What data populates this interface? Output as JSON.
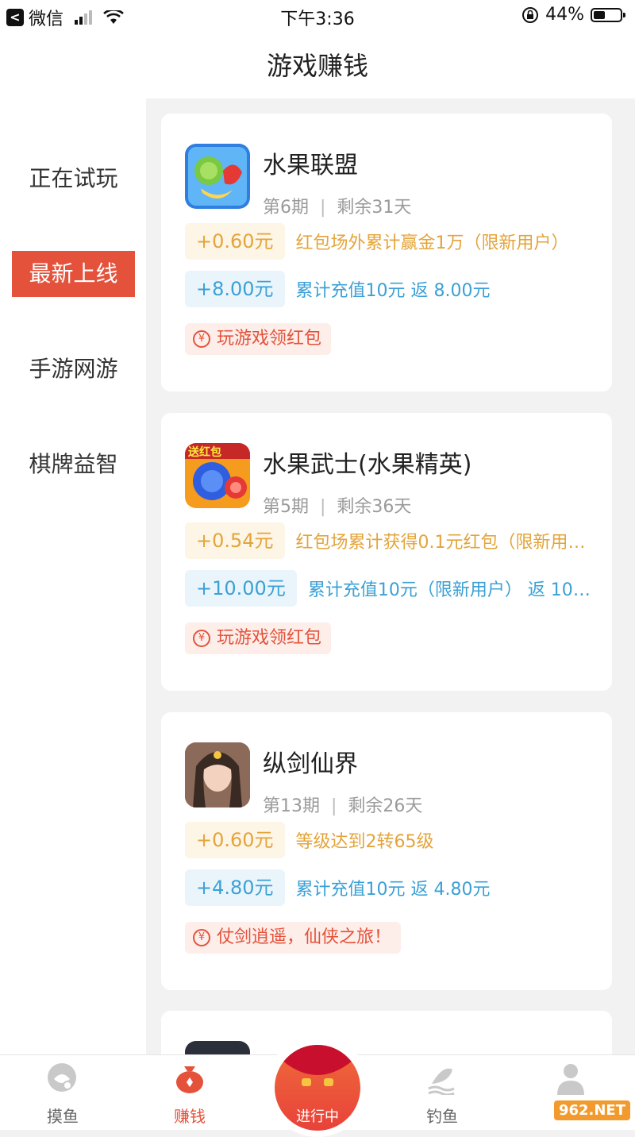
{
  "status_bar": {
    "back_app": "微信",
    "time": "下午3:36",
    "battery_pct": "44%",
    "battery_level": 0.44
  },
  "header": {
    "title": "游戏赚钱"
  },
  "sidebar": {
    "items": [
      {
        "label": "正在试玩",
        "active": false
      },
      {
        "label": "最新上线",
        "active": true
      },
      {
        "label": "手游网游",
        "active": false
      },
      {
        "label": "棋牌益智",
        "active": false
      }
    ]
  },
  "games": [
    {
      "name": "水果联盟",
      "period": "第6期",
      "remaining": "剩余31天",
      "rewards": [
        {
          "amount": "+0.60元",
          "desc": "红包场外累计赢金1万（限新用户）",
          "color": "orange"
        },
        {
          "amount": "+8.00元",
          "desc": "累计充值10元 返 8.00元",
          "color": "blue"
        }
      ],
      "tag": "玩游戏领红包"
    },
    {
      "name": "水果武士(水果精英)",
      "period": "第5期",
      "remaining": "剩余36天",
      "icon_badge": "送红包",
      "rewards": [
        {
          "amount": "+0.54元",
          "desc": "红包场累计获得0.1元红包（限新用…",
          "color": "orange"
        },
        {
          "amount": "+10.00元",
          "desc": "累计充值10元（限新用户） 返 10.…",
          "color": "blue"
        }
      ],
      "tag": "玩游戏领红包"
    },
    {
      "name": "纵剑仙界",
      "period": "第13期",
      "remaining": "剩余26天",
      "rewards": [
        {
          "amount": "+0.60元",
          "desc": "等级达到2转65级",
          "color": "orange"
        },
        {
          "amount": "+4.80元",
          "desc": "累计充值10元 返 4.80元",
          "color": "blue"
        }
      ],
      "tag": "仗剑逍遥，仙侠之旅！"
    }
  ],
  "bottom_nav": {
    "items": [
      {
        "label": "摸鱼",
        "icon": "fish-icon"
      },
      {
        "label": "赚钱",
        "icon": "money-bag-icon",
        "active": true
      },
      {
        "label": "进行中",
        "icon": "red-envelope-icon"
      },
      {
        "label": "钓鱼",
        "icon": "fishing-icon"
      },
      {
        "label": "",
        "icon": "user-icon"
      }
    ]
  },
  "watermark": "962.NET",
  "colors": {
    "accent": "#e4523b",
    "orange": "#e4a43a",
    "blue": "#3ba0d6"
  }
}
